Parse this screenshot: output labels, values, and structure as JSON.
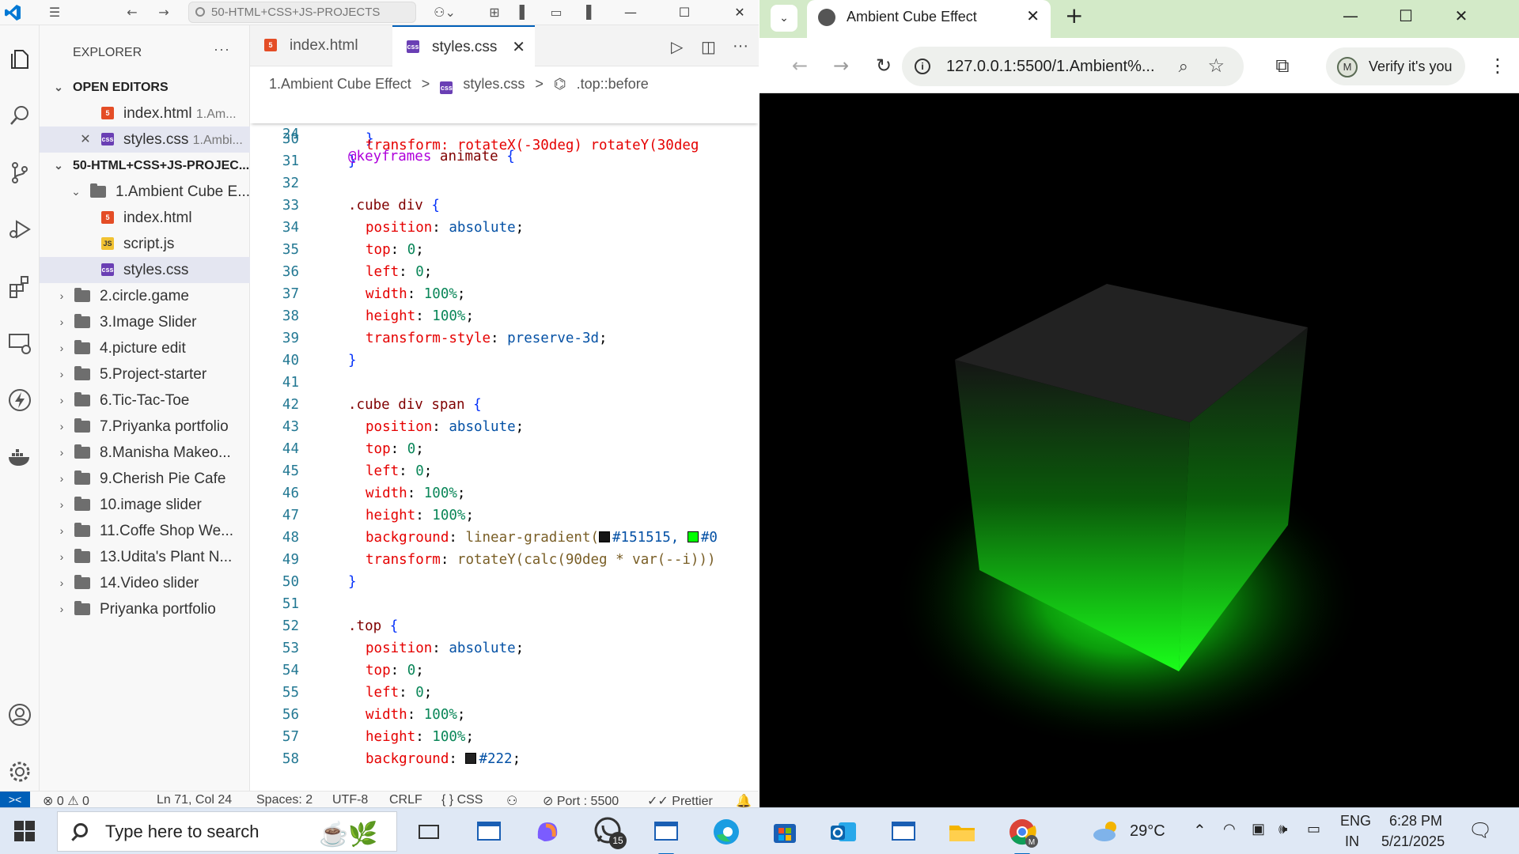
{
  "vscode": {
    "command_center": "50-HTML+CSS+JS-PROJECTS",
    "explorer": {
      "title": "EXPLORER",
      "open_editors_title": "OPEN EDITORS",
      "open_editors": [
        {
          "name": "index.html",
          "path": "1.Am..."
        },
        {
          "name": "styles.css",
          "path": "1.Ambi..."
        }
      ],
      "workspace_title": "50-HTML+CSS+JS-PROJEC...",
      "root_folder": "1.Ambient Cube E...",
      "root_files": [
        "index.html",
        "script.js",
        "styles.css"
      ],
      "folders": [
        "2.circle.game",
        "3.Image Slider",
        "4.picture edit",
        "5.Project-starter",
        "6.Tic-Tac-Toe",
        "7.Priyanka portfolio",
        "8.Manisha Makeo...",
        "9.Cherish Pie Cafe",
        "10.image slider",
        "11.Coffe Shop We...",
        "13.Udita's Plant N...",
        "14.Video slider",
        "Priyanka portfolio"
      ]
    },
    "tabs": [
      {
        "label": "index.html"
      },
      {
        "label": "styles.css"
      }
    ],
    "breadcrumbs": [
      "1.Ambient Cube Effect",
      ">",
      "styles.css",
      ">",
      ".top::before"
    ],
    "code": {
      "l24_num": "24",
      "l30_num": "30",
      "l31_num": "31",
      "l32_num": "32",
      "l33_num": "33",
      "l34_num": "34",
      "l35_num": "35",
      "l36_num": "36",
      "l37_num": "37",
      "l38_num": "38",
      "l39_num": "39",
      "l40_num": "40",
      "l41_num": "41",
      "l42_num": "42",
      "l43_num": "43",
      "l44_num": "44",
      "l45_num": "45",
      "l46_num": "46",
      "l47_num": "47",
      "l48_num": "48",
      "l49_num": "49",
      "l50_num": "50",
      "l51_num": "51",
      "l52_num": "52",
      "l53_num": "53",
      "l54_num": "54",
      "l55_num": "55",
      "l56_num": "56",
      "l57_num": "57",
      "l58_num": "58",
      "keyframes": "@keyframes",
      "animate": "animate",
      "sel_cube_div": ".cube div",
      "sel_cube_div_span": ".cube div span",
      "sel_top": ".top",
      "p_position": "position",
      "p_top": "top",
      "p_left": "left",
      "p_width": "width",
      "p_height": "height",
      "p_transform_style": "transform-style",
      "p_background": "background",
      "p_transform": "transform",
      "v_absolute": "absolute",
      "v_zero": "0",
      "v_100": "100%",
      "v_preserve": "preserve-3d",
      "v_linear": "linear-gradient(",
      "v_151515": "#151515,",
      "v_hash0": "#0",
      "v_rotate": "rotateY(calc(90deg * var(--i)))",
      "v_222": "#222",
      "scrolled_fragment": "transform: rotateX(-30deg) rotateY(30deg"
    },
    "status": {
      "errors": "0",
      "warnings": "0",
      "cursor": "Ln 71, Col 24",
      "spaces": "Spaces: 2",
      "encoding": "UTF-8",
      "eol": "CRLF",
      "language": "CSS",
      "port": "Port : 5500",
      "prettier": "Prettier"
    }
  },
  "browser": {
    "tab_title": "Ambient Cube Effect",
    "url": "127.0.0.1:5500/1.Ambient%...",
    "verify_label": "Verify it's you",
    "avatar_letter": "M"
  },
  "taskbar": {
    "search_placeholder": "Type here to search",
    "whatsapp_badge": "15",
    "weather": "29°C",
    "lang_top": "ENG",
    "lang_bottom": "IN",
    "time": "6:28 PM",
    "date": "5/21/2025"
  },
  "colors": {
    "vscode_accent": "#005fb8",
    "cube_glow": "#1aff1a",
    "swatch_151515": "#151515",
    "swatch_green": "#00ff00",
    "swatch_222": "#222222"
  }
}
